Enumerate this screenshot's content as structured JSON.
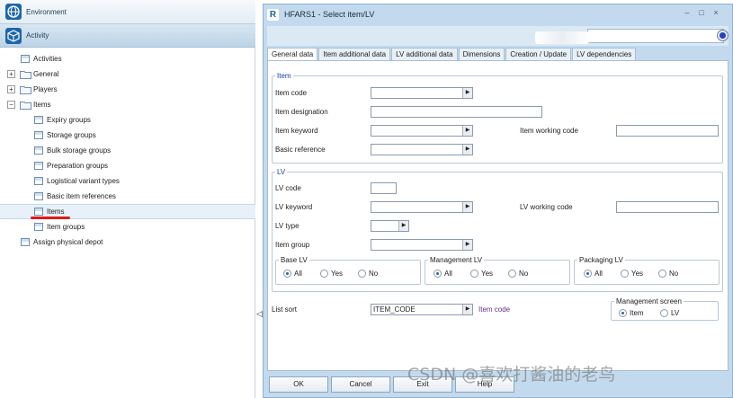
{
  "left_panel": {
    "environment_header": "Environment",
    "activity_header": "Activity",
    "tree": [
      {
        "label": "Activities",
        "level": 0,
        "kind": "doc",
        "expander": ""
      },
      {
        "label": "General",
        "level": 0,
        "kind": "folder",
        "expander": "+"
      },
      {
        "label": "Players",
        "level": 0,
        "kind": "folder",
        "expander": "+"
      },
      {
        "label": "Items",
        "level": 0,
        "kind": "folder",
        "expander": "−"
      },
      {
        "label": "Expiry groups",
        "level": 1,
        "kind": "doc",
        "expander": ""
      },
      {
        "label": "Storage groups",
        "level": 1,
        "kind": "doc",
        "expander": ""
      },
      {
        "label": "Bulk storage groups",
        "level": 1,
        "kind": "doc",
        "expander": ""
      },
      {
        "label": "Preparation groups",
        "level": 1,
        "kind": "doc",
        "expander": ""
      },
      {
        "label": "Logistical variant types",
        "level": 1,
        "kind": "doc",
        "expander": ""
      },
      {
        "label": "Basic item references",
        "level": 1,
        "kind": "doc",
        "expander": ""
      },
      {
        "label": "Items",
        "level": 1,
        "kind": "doc",
        "expander": "",
        "selected": true
      },
      {
        "label": "Item groups",
        "level": 1,
        "kind": "doc",
        "expander": ""
      },
      {
        "label": "Assign physical depot",
        "level": 0,
        "kind": "doc",
        "expander": ""
      }
    ]
  },
  "splitter": {
    "arrow": "◁"
  },
  "dialog": {
    "logo": "R",
    "title": "HFARS1 - Select item/LV",
    "window_buttons": [
      "–",
      "□",
      "×"
    ],
    "tabs": [
      "General data",
      "Item additional data",
      "LV additional data",
      "Dimensions",
      "Creation / Update",
      "LV dependencies"
    ],
    "item_group": {
      "legend": "Item",
      "item_code": "Item code",
      "item_designation": "Item designation",
      "item_keyword": "Item keyword",
      "item_working_code": "Item working code",
      "basic_reference": "Basic reference"
    },
    "lv_group": {
      "legend": "LV",
      "lv_code": "LV code",
      "lv_keyword": "LV keyword",
      "lv_working_code": "LV working code",
      "lv_type": "LV type",
      "item_group": "Item group",
      "base_lv": {
        "legend": "Base LV",
        "options": [
          "All",
          "Yes",
          "No"
        ],
        "selected": "All"
      },
      "management_lv": {
        "legend": "Management LV",
        "options": [
          "All",
          "Yes",
          "No"
        ],
        "selected": "All"
      },
      "packaging_lv": {
        "legend": "Packaging LV",
        "options": [
          "All",
          "Yes",
          "No"
        ],
        "selected": "All"
      }
    },
    "list_sort": {
      "label": "List sort",
      "value": "ITEM_CODE",
      "hint": "Item code"
    },
    "management_screen": {
      "legend": "Management screen",
      "options": [
        "Item",
        "LV"
      ],
      "selected": "Item"
    },
    "buttons": {
      "ok": "OK",
      "cancel": "Cancel",
      "exit": "Exit",
      "help": "Help"
    }
  },
  "watermark": "CSDN @喜欢打酱油的老鸟",
  "colors": {
    "selection_underline": "#e01818",
    "legend_blue": "#1a3ea8",
    "hint_purple": "#6a2b8f",
    "dialog_bg": "#c3daee"
  }
}
